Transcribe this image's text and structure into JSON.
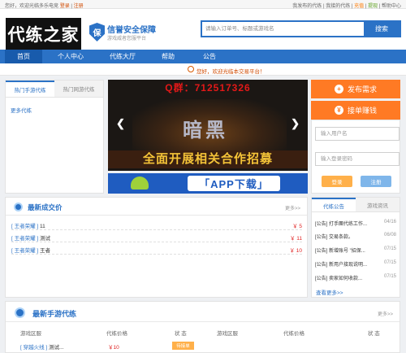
{
  "topbar": {
    "greeting": "您好，欢迎光临多乐电竞",
    "login": "登录",
    "sep": "|",
    "register": "注册",
    "links": [
      "我发布的代练",
      "我接的代练",
      "充值",
      "提现",
      "帮助中心"
    ]
  },
  "header": {
    "logo": "代练之家",
    "badge": "保",
    "safe_title": "信誉安全保障",
    "safe_sub": "游戏威者您服平台"
  },
  "search": {
    "placeholder": "请输入订单号、标题或游戏名",
    "button": "搜索"
  },
  "nav": [
    "首页",
    "个人中心",
    "代练大厅",
    "帮助",
    "公告"
  ],
  "notice": "您好，欢迎光临本交易平台！",
  "left_panel": {
    "tabs": [
      "热门手游代练",
      "热门网游代练"
    ],
    "link": "更多代练"
  },
  "banner": {
    "qq": "Q群：712517326",
    "headline": "全面开展相关合作招募",
    "app": "「APP下载」"
  },
  "right_panel": {
    "publish": "发布需求",
    "take": "接单赚钱",
    "username_placeholder": "输入用户名",
    "password_placeholder": "输入登录密码",
    "login": "登录",
    "register": "注册"
  },
  "deals": {
    "title": "最新成交价",
    "more": "更多>>",
    "rows": [
      {
        "tag": "[ 王者荣耀 ]",
        "name": "11",
        "price": "￥ 5"
      },
      {
        "tag": "[ 王者荣耀 ]",
        "name": "测试",
        "price": "￥ 11"
      },
      {
        "tag": "[ 王者荣耀 ]",
        "name": "王者",
        "price": "￥ 10"
      }
    ]
  },
  "news": {
    "tabs": [
      "代练公告",
      "游戏资讯"
    ],
    "rows": [
      {
        "title": "[公告] 打手團代练工作...",
        "date": "04/16"
      },
      {
        "title": "[公告] 交易条款。",
        "date": "06/08"
      },
      {
        "title": "[公告] 新增账号 \"招保...",
        "date": "07/15"
      },
      {
        "title": "[公告] 新用户接现说明...",
        "date": "07/15"
      },
      {
        "title": "[公告] 卖家如何收款...",
        "date": "07/15"
      }
    ],
    "more": "查看更多>>"
  },
  "latest": {
    "title": "最新手游代练",
    "more": "更多>>",
    "cols": [
      "游戏区服",
      "代练价格",
      "状 态",
      "游戏区服",
      "代练价格",
      "状 态"
    ],
    "row": {
      "tag": "[ 穿越火线 ]",
      "name": "测试...",
      "price": "￥10",
      "status": "待接单"
    }
  },
  "colors": {
    "primary": "#2b72c6",
    "orange": "#ff7a24",
    "price": "#e02020"
  }
}
